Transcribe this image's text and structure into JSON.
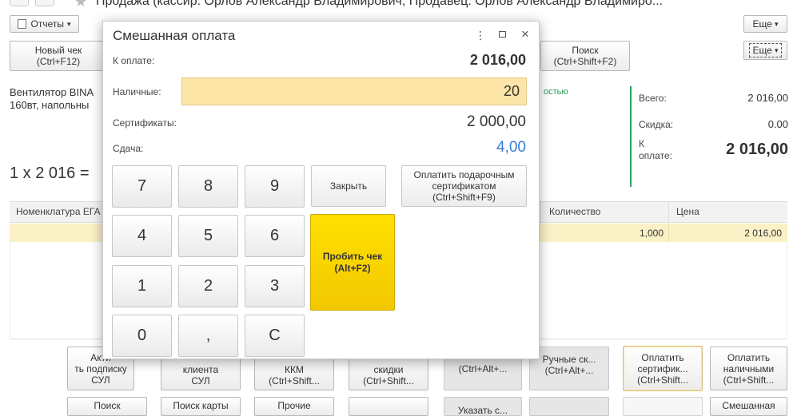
{
  "window": {
    "title": "Продажа (кассир: Орлов Александр Владимирович, Продавец: Орлов Александр Владимиро...",
    "reports_label": "Отчеты",
    "more_label": "Еще",
    "more2_label": "Еще"
  },
  "toolbar": {
    "new_check": "Новый чек\n(Ctrl+F12)",
    "search": "Поиск\n(Ctrl+Shift+F2)"
  },
  "product": {
    "name": "Вентилятор BINA\n160вт, напольны",
    "qty_price": "1 x 2 016 =",
    "green_text": "остью"
  },
  "summary": {
    "total_label": "Всего:",
    "total_value": "2 016,00",
    "discount_label": "Скидка:",
    "discount_value": "0.00",
    "due_label": "К\nоплате:",
    "due_value": "2 016,00"
  },
  "table": {
    "columns": [
      "Номенклатура ЕГА",
      "Количество",
      "Цена"
    ],
    "rows": [
      {
        "qty": "1,000",
        "price": "2 016,00"
      }
    ]
  },
  "bottom_buttons_row1": [
    "Акти\nть подписку\nСУЛ",
    "клиента\nСУЛ",
    "ККМ\n(Ctrl+Shift...",
    "скидки\n(Ctrl+Shift...",
    "(Ctrl+Alt+...",
    "Ручные ск...\n(Ctrl+Alt+...",
    "Оплатить\nсертифик...\n(Ctrl+Shift...",
    "Оплатить\nналичными\n(Ctrl+Shift..."
  ],
  "bottom_buttons_row2": [
    "Поиск",
    "Поиск карты",
    "Прочие",
    "",
    "Указать с...",
    "",
    "",
    "Смешанная"
  ],
  "modal": {
    "title": "Смешанная оплата",
    "due_label": "К оплате:",
    "due_value": "2 016,00",
    "cash_label": "Наличные:",
    "cash_value": "20",
    "cert_label": "Сертификаты:",
    "cert_value": "2 000,00",
    "change_label": "Сдача:",
    "change_value": "4,00",
    "keys": [
      "7",
      "8",
      "9",
      "4",
      "5",
      "6",
      "1",
      "2",
      "3",
      "0",
      ",",
      "C"
    ],
    "close_label": "Закрыть",
    "gift_label": "Оплатить подарочным\nсертификатом\n(Ctrl+Shift+F9)",
    "pay_label": "Пробить чек\n(Alt+F2)",
    "colors": {
      "accent_blue": "#3a7bd5",
      "yellow": "#ffe000",
      "input_bg": "#fde4a7"
    }
  }
}
